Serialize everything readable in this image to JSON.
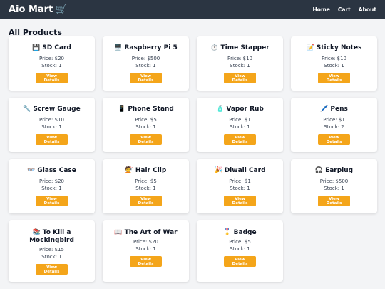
{
  "navbar": {
    "brand": "Aio Mart",
    "brand_icon": "🛒",
    "links": [
      "Home",
      "Cart",
      "About"
    ]
  },
  "page_title": "All Products",
  "button_label": "View Details",
  "products": [
    {
      "icon": "💾",
      "name": "SD Card",
      "price": "Price: $20",
      "stock": "Stock: 1"
    },
    {
      "icon": "🖥️",
      "name": "Raspberry Pi 5",
      "price": "Price: $500",
      "stock": "Stock: 1"
    },
    {
      "icon": "⏱️",
      "name": "Time Stapper",
      "price": "Price: $10",
      "stock": "Stock: 1"
    },
    {
      "icon": "📝",
      "name": "Sticky Notes",
      "price": "Price: $10",
      "stock": "Stock: 1"
    },
    {
      "icon": "🔧",
      "name": "Screw Gauge",
      "price": "Price: $10",
      "stock": "Stock: 1"
    },
    {
      "icon": "📱",
      "name": "Phone Stand",
      "price": "Price: $5",
      "stock": "Stock: 1"
    },
    {
      "icon": "🧴",
      "name": "Vapor Rub",
      "price": "Price: $1",
      "stock": "Stock: 1"
    },
    {
      "icon": "🖊️",
      "name": "Pens",
      "price": "Price: $1",
      "stock": "Stock: 2"
    },
    {
      "icon": "👓",
      "name": "Glass Case",
      "price": "Price: $20",
      "stock": "Stock: 1"
    },
    {
      "icon": "💇",
      "name": "Hair Clip",
      "price": "Price: $5",
      "stock": "Stock: 1"
    },
    {
      "icon": "🎉",
      "name": "Diwali Card",
      "price": "Price: $1",
      "stock": "Stock: 1"
    },
    {
      "icon": "🎧",
      "name": "Earplug",
      "price": "Price: $500",
      "stock": "Stock: 1"
    },
    {
      "icon": "📚",
      "name": "To Kill a Mockingbird",
      "price": "Price: $15",
      "stock": "Stock: 1"
    },
    {
      "icon": "📖",
      "name": "The Art of War",
      "price": "Price: $20",
      "stock": "Stock: 1"
    },
    {
      "icon": "🎖️",
      "name": "Badge",
      "price": "Price: $5",
      "stock": "Stock: 1"
    }
  ]
}
